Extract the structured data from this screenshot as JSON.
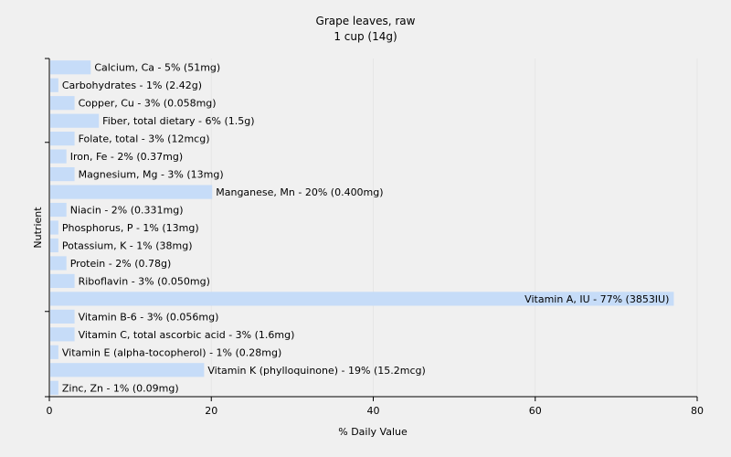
{
  "chart_data": {
    "type": "bar",
    "orientation": "horizontal",
    "title": "Grape leaves, raw",
    "subtitle": "1 cup (14g)",
    "xlabel": "% Daily Value",
    "ylabel": "Nutrient",
    "xlim": [
      0,
      80
    ],
    "xticks": [
      0,
      20,
      40,
      60,
      80
    ],
    "grid": true,
    "bar_color": "#c6dcf8",
    "categories": [
      "Calcium, Ca",
      "Carbohydrates",
      "Copper, Cu",
      "Fiber, total dietary",
      "Folate, total",
      "Iron, Fe",
      "Magnesium, Mg",
      "Manganese, Mn",
      "Niacin",
      "Phosphorus, P",
      "Potassium, K",
      "Protein",
      "Riboflavin",
      "Vitamin A, IU",
      "Vitamin B-6",
      "Vitamin C, total ascorbic acid",
      "Vitamin E (alpha-tocopherol)",
      "Vitamin K (phylloquinone)",
      "Zinc, Zn"
    ],
    "values": [
      5,
      1,
      3,
      6,
      3,
      2,
      3,
      20,
      2,
      1,
      1,
      2,
      3,
      77,
      3,
      3,
      1,
      19,
      1
    ],
    "amounts": [
      "51mg",
      "2.42g",
      "0.058mg",
      "1.5g",
      "12mcg",
      "0.37mg",
      "13mg",
      "0.400mg",
      "0.331mg",
      "13mg",
      "38mg",
      "0.78g",
      "0.050mg",
      "3853IU",
      "0.056mg",
      "1.6mg",
      "0.28mg",
      "15.2mcg",
      "0.09mg"
    ],
    "labels": [
      "Calcium, Ca - 5% (51mg)",
      "Carbohydrates - 1% (2.42g)",
      "Copper, Cu - 3% (0.058mg)",
      "Fiber, total dietary - 6% (1.5g)",
      "Folate, total - 3% (12mcg)",
      "Iron, Fe - 2% (0.37mg)",
      "Magnesium, Mg - 3% (13mg)",
      "Manganese, Mn - 20% (0.400mg)",
      "Niacin - 2% (0.331mg)",
      "Phosphorus, P - 1% (13mg)",
      "Potassium, K - 1% (38mg)",
      "Protein - 2% (0.78g)",
      "Riboflavin - 3% (0.050mg)",
      "Vitamin A, IU - 77% (3853IU)",
      "Vitamin B-6 - 3% (0.056mg)",
      "Vitamin C, total ascorbic acid - 3% (1.6mg)",
      "Vitamin E (alpha-tocopherol) - 1% (0.28mg)",
      "Vitamin K (phylloquinone) - 19% (15.2mcg)",
      "Zinc, Zn - 1% (0.09mg)"
    ]
  }
}
